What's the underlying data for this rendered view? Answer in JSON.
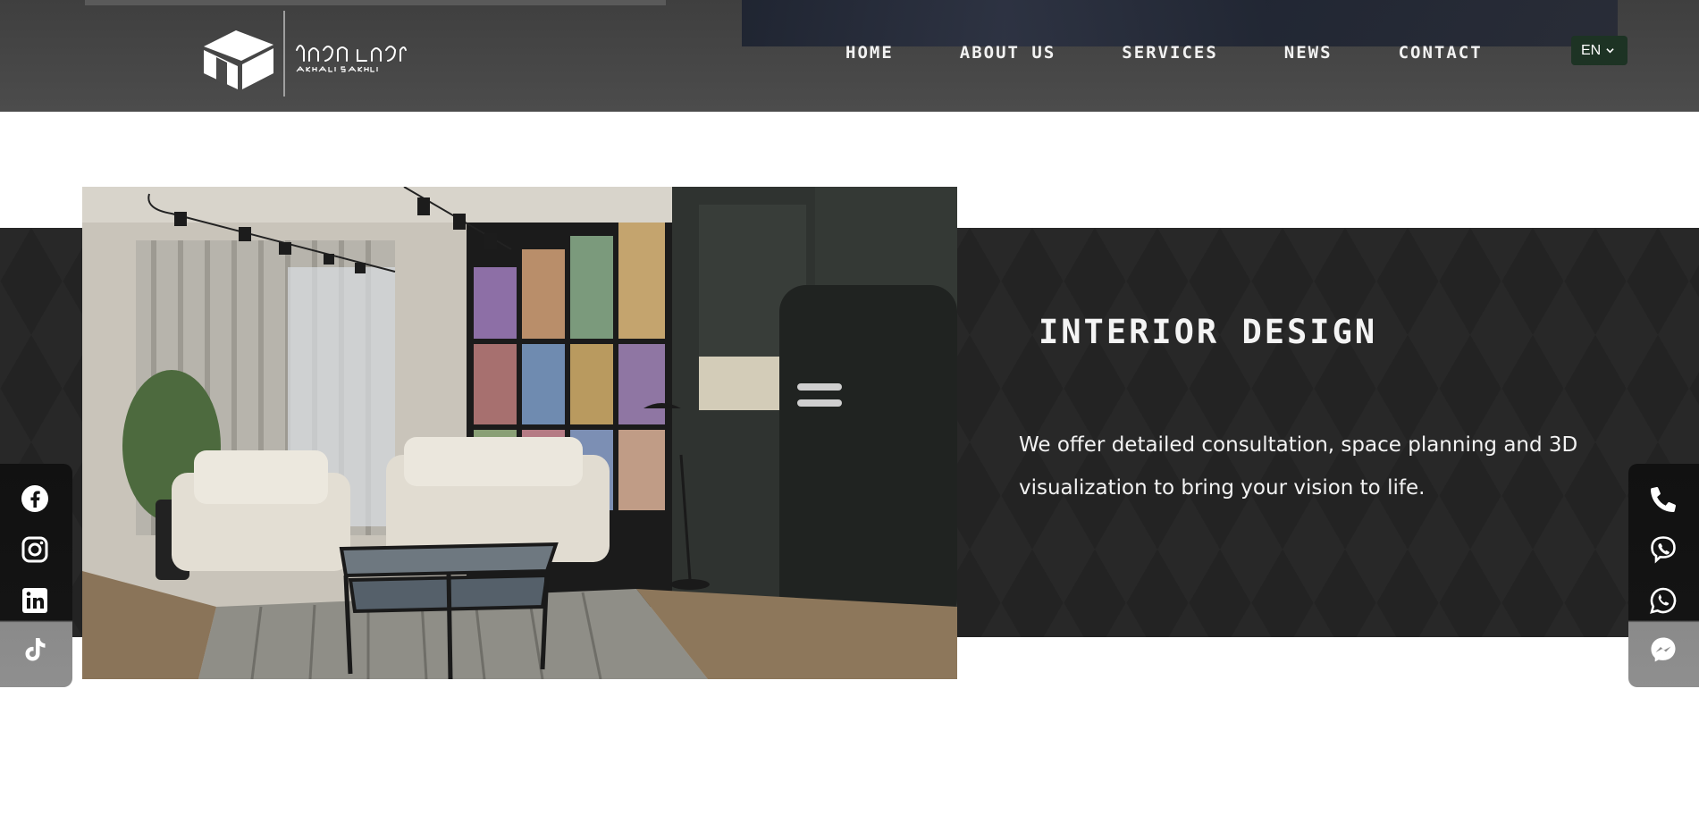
{
  "header": {
    "logo_alt": "ახალი სახლი",
    "logo_subtext": "AKHALI SAKHLI",
    "nav": [
      {
        "label": "HOME"
      },
      {
        "label": "ABOUT US"
      },
      {
        "label": "SERVICES"
      },
      {
        "label": "NEWS"
      },
      {
        "label": "CONTACT"
      }
    ],
    "language": {
      "selected": "EN"
    }
  },
  "feature": {
    "title": "INTERIOR DESIGN",
    "description": "We offer detailed consultation, space planning and 3D visualization to bring your vision to life."
  },
  "social_links": [
    {
      "icon": "facebook-icon"
    },
    {
      "icon": "instagram-icon"
    },
    {
      "icon": "linkedin-icon"
    },
    {
      "icon": "tiktok-icon"
    }
  ],
  "contact_links": [
    {
      "icon": "phone-icon"
    },
    {
      "icon": "viber-icon"
    },
    {
      "icon": "whatsapp-icon"
    },
    {
      "icon": "messenger-icon"
    }
  ],
  "colors": {
    "header_bg": "#484848",
    "band_bg": "#232323",
    "lang_bg": "#1d3324",
    "text_light": "#f2f2f2"
  }
}
